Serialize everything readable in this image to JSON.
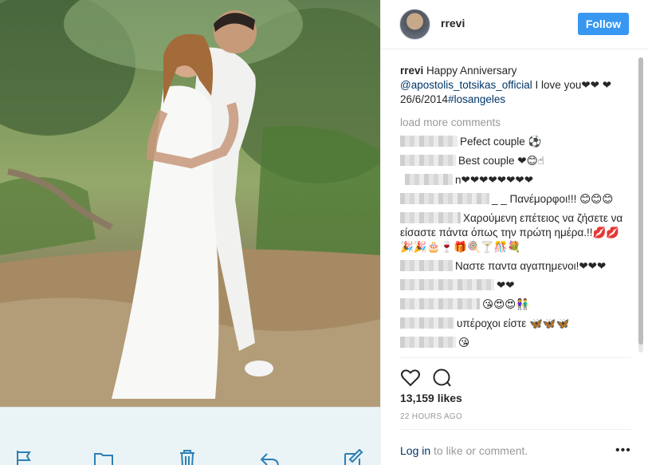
{
  "post": {
    "username": "rrevi",
    "follow_label": "Follow",
    "caption_user": "rrevi",
    "caption_text": " Happy Anniversary ",
    "caption_mention": "@apostolis_totsikas_official",
    "caption_text2": " I love you❤❤ ❤26/6/2014",
    "caption_hashtag": "#losangeles",
    "load_more": "load more comments",
    "likes": "13,159 likes",
    "time": "22 HOURS AGO"
  },
  "comments": [
    {
      "text": "Pefect couple ⚽"
    },
    {
      "text": "Best couple ❤😊☝"
    },
    {
      "text": "n❤❤❤❤❤❤❤❤"
    },
    {
      "text": "_ _ Πανέμορφοι!!! 😊😊😊"
    },
    {
      "text": "Χαρούμενη επέτειος να ζήσετε να είσαστε πάντα όπως την πρώτη ημέρα.!!💋💋🎉🎉🎂🍷🎁🍭🍸🎊💐"
    },
    {
      "text": "Ναστε παντα αγαπημενοι!❤❤❤"
    },
    {
      "text": "❤❤"
    },
    {
      "text": "😘😍😍👫"
    },
    {
      "text": "υπέροχοι είστε 🦋🦋🦋"
    },
    {
      "text": "😘"
    }
  ],
  "footer": {
    "login_label": "Log in",
    "login_suffix": " to like or comment.",
    "more_label": "•••"
  },
  "toolbar": {
    "icons": [
      "flag-icon",
      "folder-icon",
      "trash-icon",
      "reply-icon",
      "compose-icon"
    ]
  },
  "colors": {
    "accent": "#3897f0",
    "link": "#003569"
  }
}
